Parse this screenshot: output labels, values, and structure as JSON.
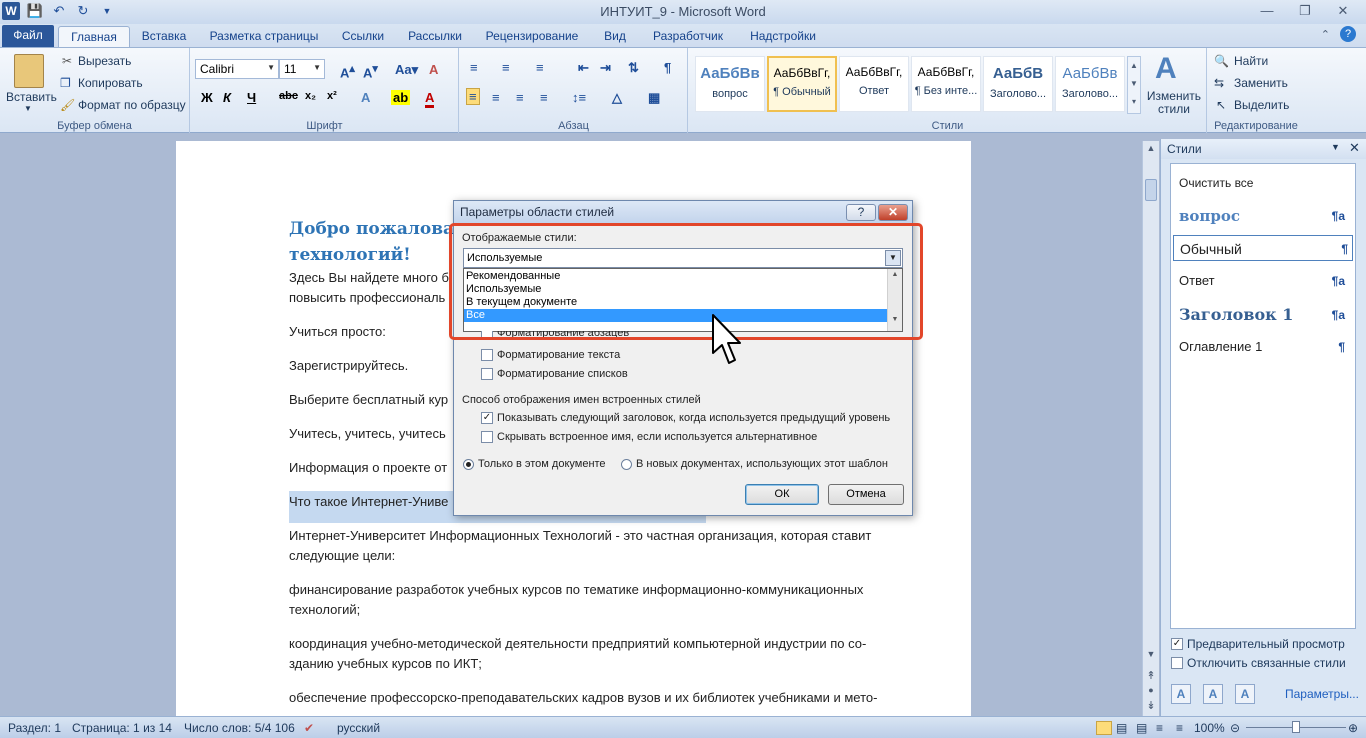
{
  "window": {
    "title": "ИНТУИТ_9 - Microsoft Word",
    "qat_icons": [
      "word-logo",
      "save-icon",
      "undo-icon",
      "redo-icon",
      "customize-icon"
    ],
    "word_logo": "W"
  },
  "tabs": [
    {
      "label": "Файл"
    },
    {
      "label": "Главная"
    },
    {
      "label": "Вставка"
    },
    {
      "label": "Разметка страницы"
    },
    {
      "label": "Ссылки"
    },
    {
      "label": "Рассылки"
    },
    {
      "label": "Рецензирование"
    },
    {
      "label": "Вид"
    },
    {
      "label": "Разработчик"
    },
    {
      "label": "Надстройки"
    }
  ],
  "ribbon": {
    "clipboard": {
      "paste": "Вставить",
      "cut": "Вырезать",
      "copy": "Копировать",
      "format_painter": "Формат по образцу",
      "label": "Буфер обмена"
    },
    "font": {
      "font_name": "Calibri",
      "font_size": "11",
      "label": "Шрифт"
    },
    "paragraph": {
      "label": "Абзац"
    },
    "styles": {
      "items": [
        {
          "sample": "АаБбВв",
          "name": "вопрос"
        },
        {
          "sample": "АаБбВвГг,",
          "name": "¶ Обычный"
        },
        {
          "sample": "АаБбВвГг,",
          "name": "Ответ"
        },
        {
          "sample": "АаБбВвГг,",
          "name": "¶ Без инте..."
        },
        {
          "sample": "АаБбВ",
          "name": "Заголово..."
        },
        {
          "sample": "АаБбВв",
          "name": "Заголово..."
        }
      ],
      "change_styles": "Изменить стили",
      "label": "Стили"
    },
    "editing": {
      "find": "Найти",
      "replace": "Заменить",
      "select": "Выделить",
      "label": "Редактирование"
    }
  },
  "document": {
    "title_line1": "Добро пожаловат",
    "title_line2": "технологий!",
    "paragraphs": [
      "Здесь Вы найдете много б",
      "повысить профессиональ",
      "Учиться просто:",
      "Зарегистрируйтесь.",
      "Выберите бесплатный кур",
      "Учитесь, учитесь, учитесь",
      "Информация о проекте от",
      "Что такое Интернет-Униве",
      "Интернет-Университет Информационных Технологий - это частная организация, которая ставит",
      "следующие цели:",
      "финансирование разработок учебных курсов по тематике информационно-коммуникационных",
      "технологий;",
      "координация учебно-методической деятельности предприятий компьютерной индустрии по со-",
      "зданию учебных курсов по ИКТ;",
      "обеспечение профессорско-преподавательских кадров вузов и их библиотек учебниками и мето-"
    ]
  },
  "styles_pane": {
    "title": "Стили",
    "items": [
      {
        "label": "Очистить все",
        "mark": ""
      },
      {
        "label": "вопрос",
        "mark": "¶a"
      },
      {
        "label": "Обычный",
        "mark": "¶"
      },
      {
        "label": "Ответ",
        "mark": "¶a"
      },
      {
        "label": "Заголовок 1",
        "mark": "¶a"
      },
      {
        "label": "Оглавление 1",
        "mark": "¶"
      }
    ],
    "preview": "Предварительный просмотр",
    "disable_linked": "Отключить связанные стили",
    "options_link": "Параметры..."
  },
  "dialog": {
    "title": "Параметры области стилей",
    "help": "?",
    "close": "✕",
    "shown_styles_label": "Отображаемые стили:",
    "shown_styles_value": "Используемые",
    "dropdown_options": [
      "Рекомендованные",
      "Используемые",
      "В текущем документе",
      "Все"
    ],
    "partial_option": "Форматирование абзацев",
    "format_text": "Форматирование текста",
    "format_lists": "Форматирование списков",
    "builtin_names_label": "Способ отображения имен встроенных стилей",
    "show_next_heading": "Показывать следующий заголовок, когда используется предыдущий уровень",
    "hide_builtin": "Скрывать встроенное имя, если используется альтернативное",
    "only_this_doc": "Только в этом документе",
    "new_docs": "В новых документах, использующих этот шаблон",
    "ok": "ОК",
    "cancel": "Отмена"
  },
  "statusbar": {
    "section": "Раздел: 1",
    "page": "Страница: 1 из 14",
    "words": "Число слов: 5/4 106",
    "language": "русский",
    "zoom": "100%"
  },
  "colors": {
    "accent": "#2b579a",
    "highlight": "#e2462a",
    "selection": "#3399ff"
  }
}
